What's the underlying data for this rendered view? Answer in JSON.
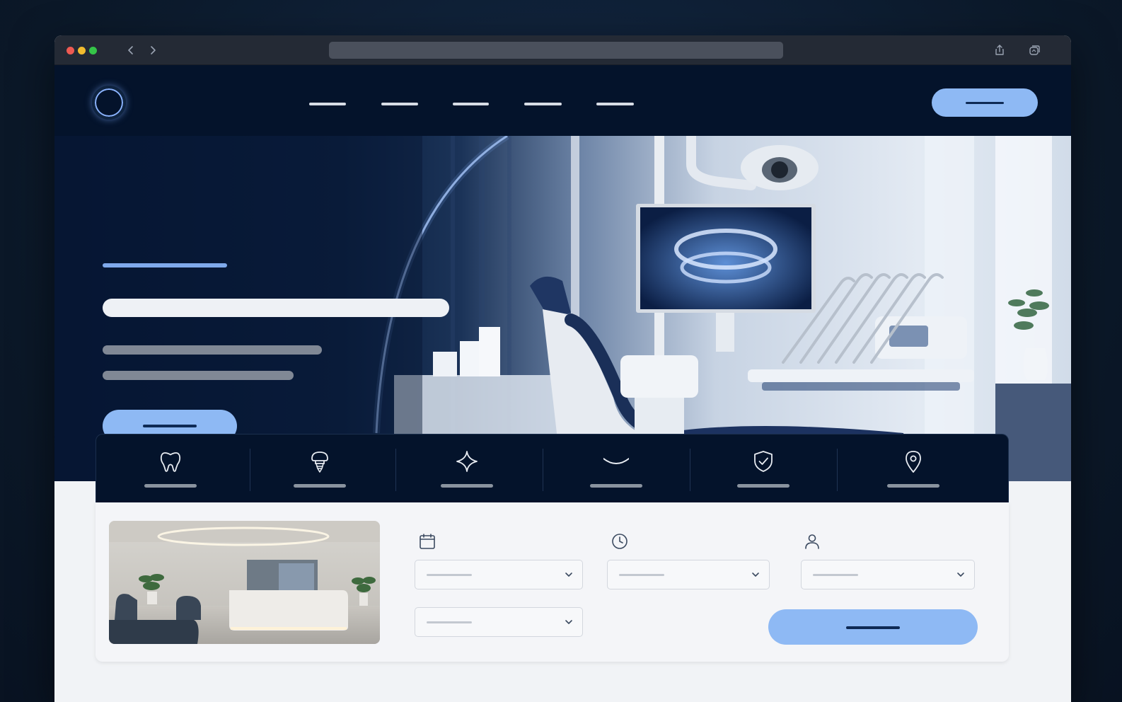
{
  "browser": {
    "url": "",
    "back_icon": "chevron-left-icon",
    "forward_icon": "chevron-right-icon",
    "share_icon": "share-icon",
    "tabs_icon": "tabs-icon"
  },
  "navbar": {
    "logo_icon": "ring-logo-icon",
    "links": [
      "",
      "",
      "",
      "",
      ""
    ],
    "cta_label": ""
  },
  "hero": {
    "eyebrow": "",
    "headline": "",
    "subtitle_line1": "",
    "subtitle_line2": "",
    "cta_label": "",
    "image": "dental-clinic-with-xray-monitor"
  },
  "services": [
    {
      "icon": "tooth-icon",
      "label": ""
    },
    {
      "icon": "implant-icon",
      "label": ""
    },
    {
      "icon": "sparkle-icon",
      "label": ""
    },
    {
      "icon": "smile-icon",
      "label": ""
    },
    {
      "icon": "shield-check-icon",
      "label": ""
    },
    {
      "icon": "location-pin-icon",
      "label": ""
    }
  ],
  "booking": {
    "image": "clinic-reception-lounge",
    "fields": [
      {
        "icon": "calendar-icon",
        "value": ""
      },
      {
        "icon": "clock-icon",
        "value": ""
      },
      {
        "icon": "user-icon",
        "value": ""
      },
      {
        "icon": "",
        "value": ""
      }
    ],
    "submit_label": ""
  },
  "colors": {
    "page_background": "#0b1828",
    "navy": "#04132b",
    "accent": "#8eb9f4",
    "accent_text": "#0e2a55",
    "panel": "#f4f5f8"
  }
}
